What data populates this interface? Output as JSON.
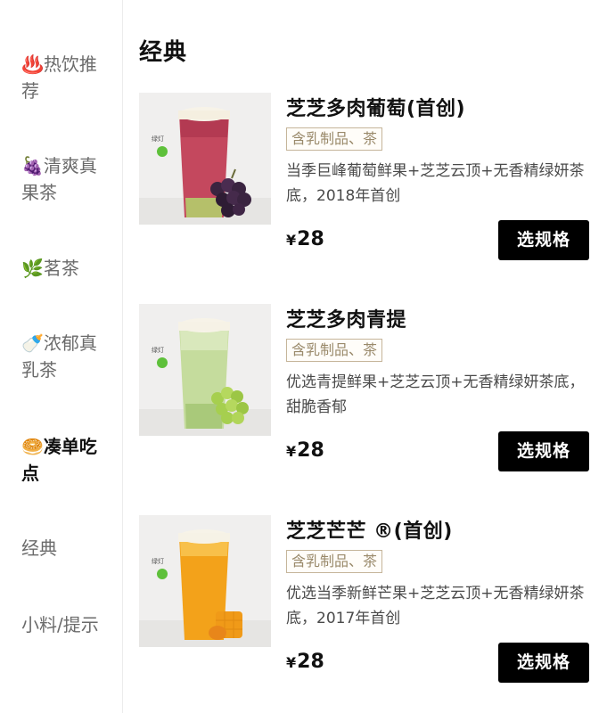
{
  "sidebar": {
    "items": [
      {
        "icon": "♨️",
        "label": "热饮推荐",
        "active": false
      },
      {
        "icon": "🍇",
        "label": "清爽真果茶",
        "active": false
      },
      {
        "icon": "🌿",
        "label": "茗茶",
        "active": false
      },
      {
        "icon": "🍼",
        "label": "浓郁真乳茶",
        "active": false
      },
      {
        "icon": "🥯",
        "label": "凑单吃点",
        "active": true
      },
      {
        "label": "经典",
        "active": false
      },
      {
        "label": "小料/提示",
        "active": false
      }
    ]
  },
  "main": {
    "section_title": "经典",
    "products": [
      {
        "name": "芝芝多肉葡萄(首创)",
        "tag": "含乳制品、茶",
        "desc": "当季巨峰葡萄鲜果+芝芝云顶+无香精绿妍茶底，2018年首创",
        "currency": "¥",
        "price": "28",
        "button": "选规格",
        "thumb_badge": "绿灯"
      },
      {
        "name": "芝芝多肉青提",
        "tag": "含乳制品、茶",
        "desc": "优选青提鲜果+芝芝云顶+无香精绿妍茶底，甜脆香郁",
        "currency": "¥",
        "price": "28",
        "button": "选规格",
        "thumb_badge": "绿灯"
      },
      {
        "name": "芝芝芒芒 ®(首创)",
        "tag": "含乳制品、茶",
        "desc": "优选当季新鲜芒果+芝芝云顶+无香精绿妍茶底，2017年首创",
        "currency": "¥",
        "price": "28",
        "button": "选规格",
        "thumb_badge": "绿灯"
      }
    ]
  },
  "colors": {
    "button_bg": "#000000",
    "tag_border": "#c5b59a",
    "sidebar_inactive": "#6b6b6b"
  }
}
